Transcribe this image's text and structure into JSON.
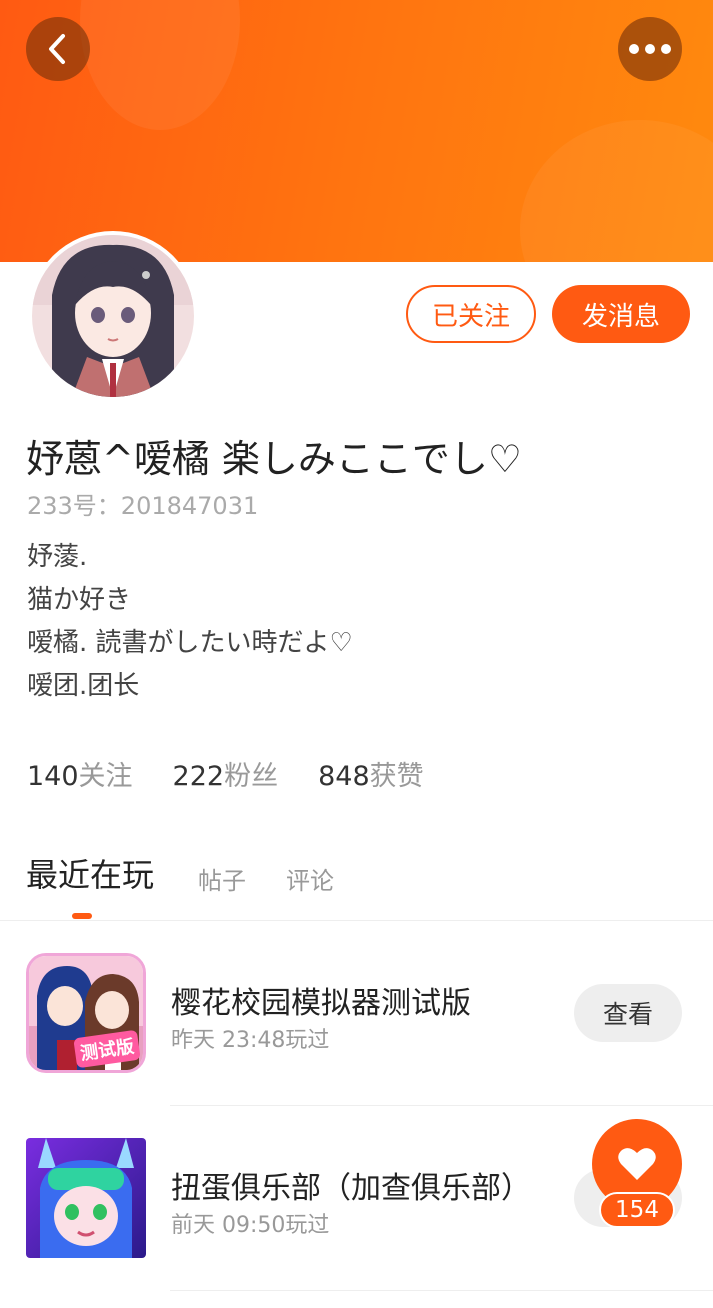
{
  "header": {
    "back_icon": "chevron-left-icon",
    "more_icon": "more-dots-icon",
    "banner_color": "#ff6a10"
  },
  "profile": {
    "follow_label": "已关注",
    "message_label": "发消息",
    "nickname": "妤蒽^嗳橘 楽しみここでし♡",
    "uid": "233号：201847031",
    "bio": [
      "妤蔆.",
      "猫か好き",
      "嗳橘. 読書がしたい時だよ♡",
      "嗳团.团长"
    ]
  },
  "stats": [
    {
      "num": "140",
      "label": "关注"
    },
    {
      "num": "222",
      "label": "粉丝"
    },
    {
      "num": "848",
      "label": "获赞"
    }
  ],
  "tabs": [
    {
      "label": "最近在玩",
      "active": true
    },
    {
      "label": "帖子",
      "active": false
    },
    {
      "label": "评论",
      "active": false
    }
  ],
  "games": [
    {
      "title": "樱花校园模拟器测试版",
      "time": "昨天 23:48玩过",
      "button": "查看",
      "icon_badge": "测试版"
    },
    {
      "title": "扭蛋俱乐部（加查俱乐部）",
      "time": "前天 09:50玩过",
      "button": "查看"
    }
  ],
  "like": {
    "count": "154",
    "icon": "heart-icon"
  },
  "colors": {
    "accent": "#ff5a12"
  }
}
